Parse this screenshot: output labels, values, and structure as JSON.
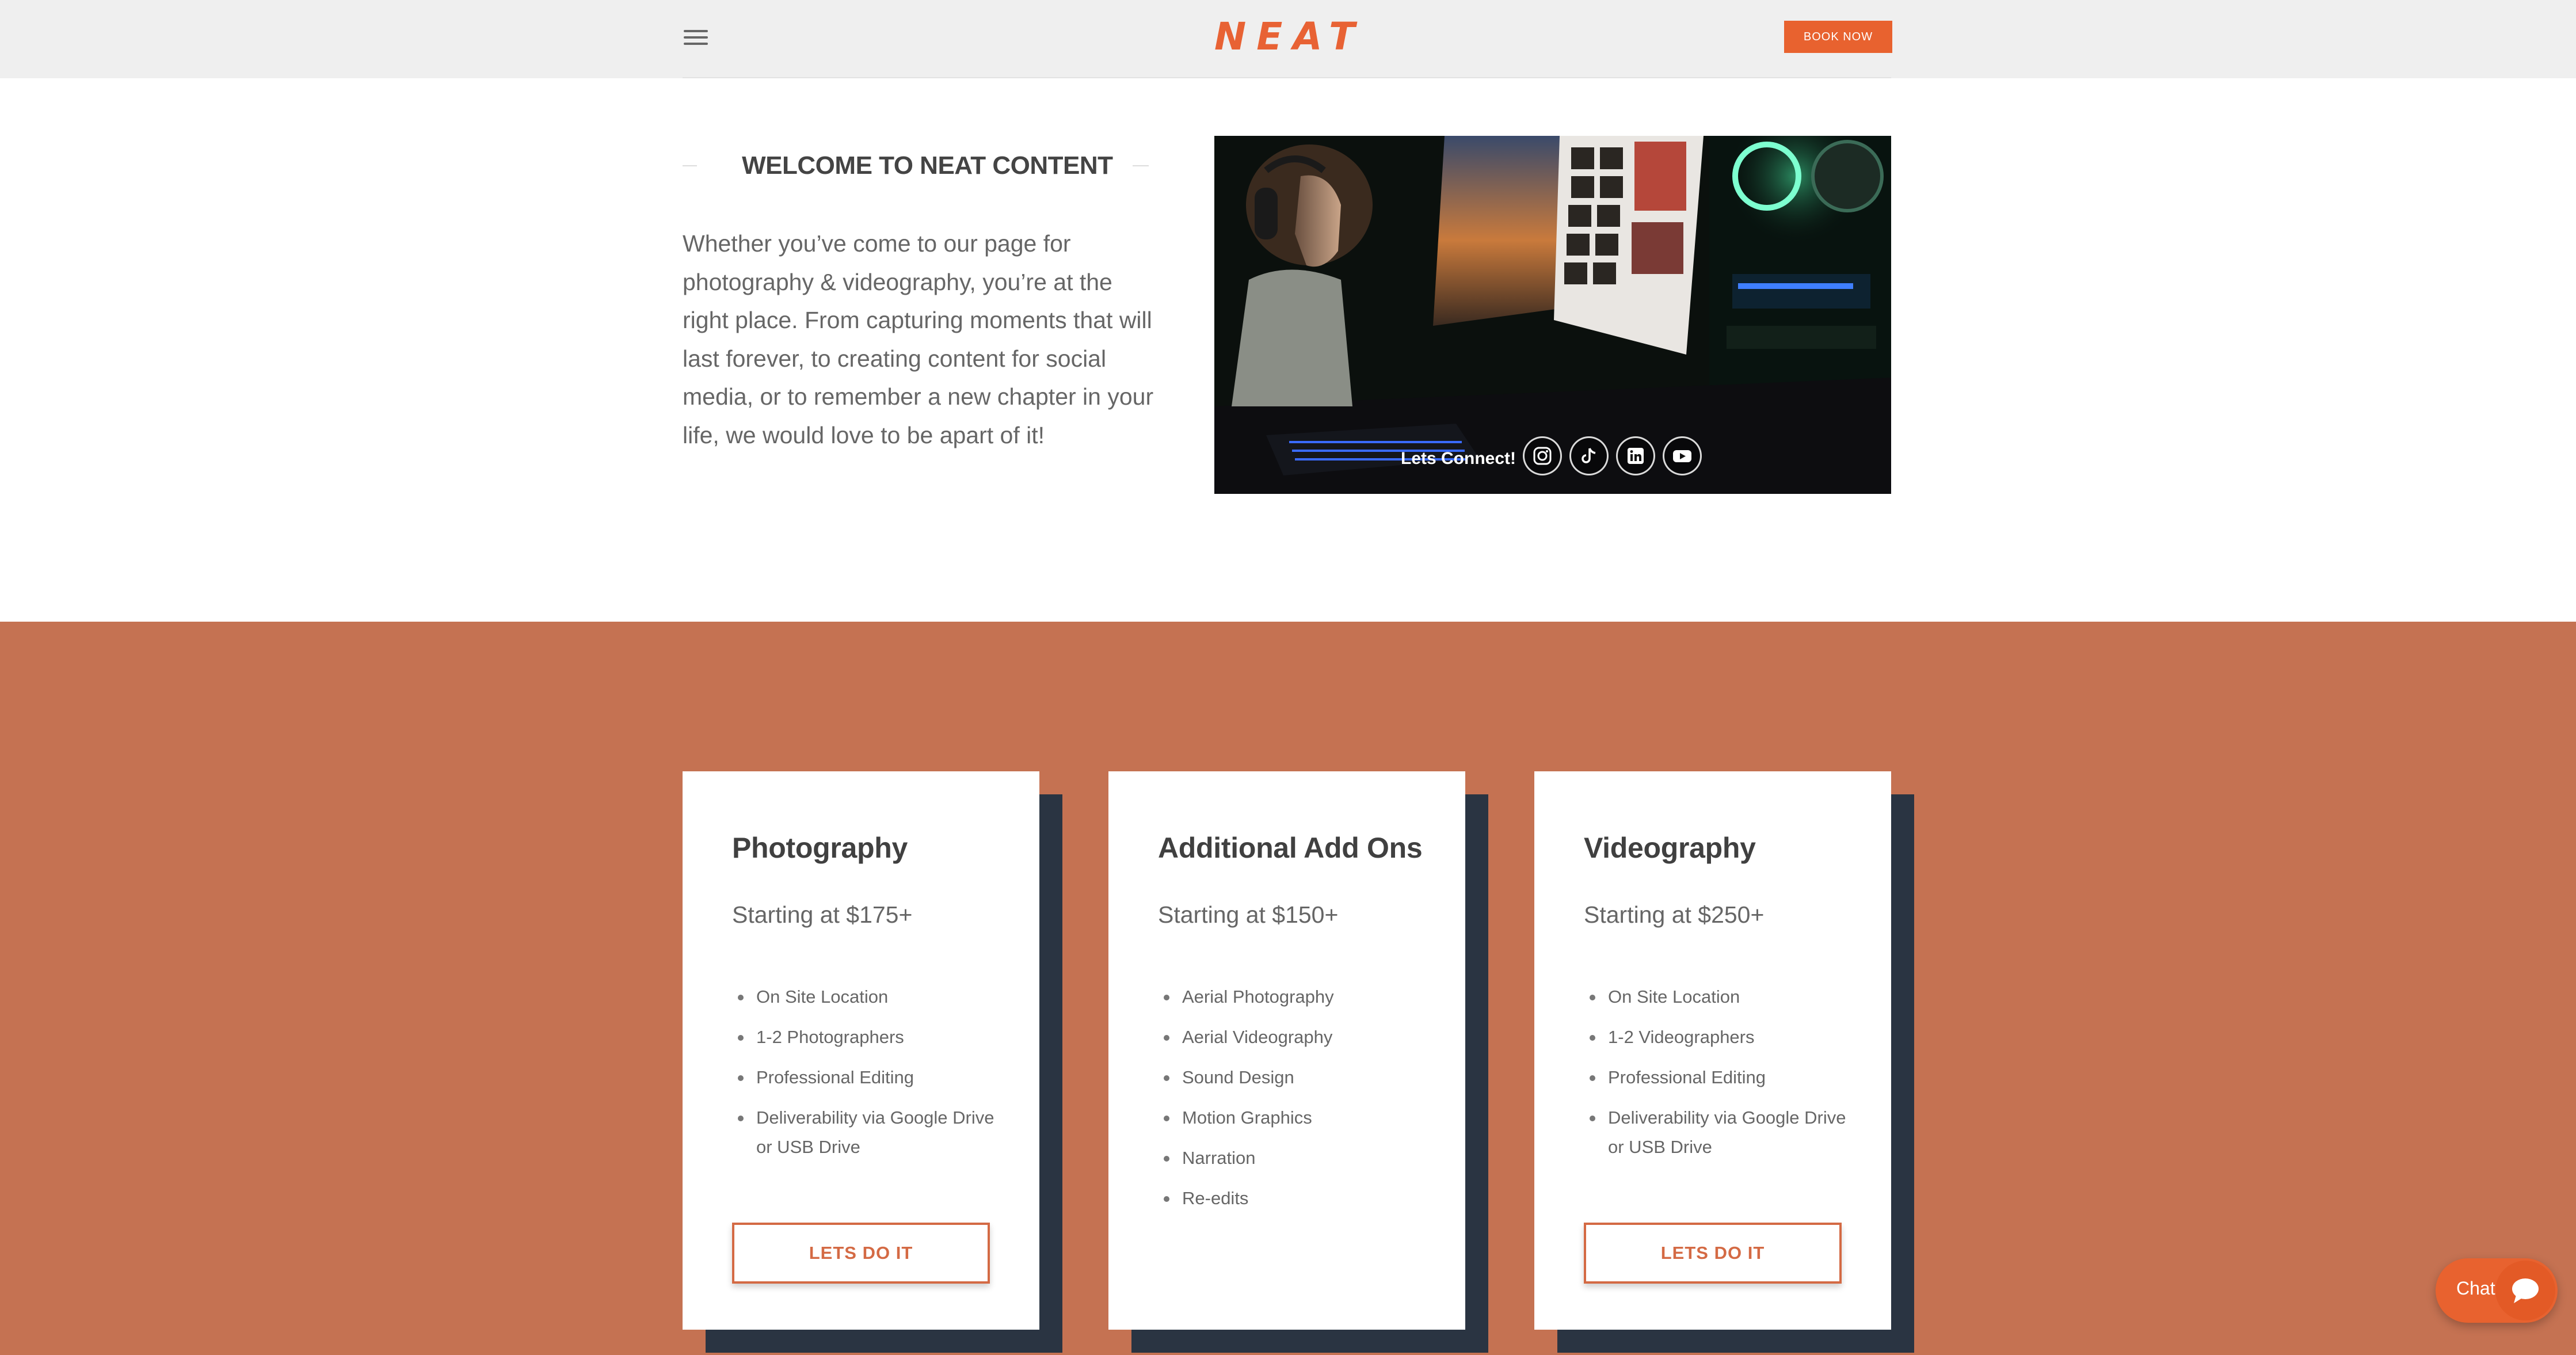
{
  "header": {
    "logo_text": "NEAT",
    "book_button": "BOOK NOW",
    "brand_color": "#e8622f"
  },
  "welcome": {
    "heading": "WELCOME TO NEAT CONTENT",
    "paragraph": "Whether you’ve come to our page for photography & videography, you’re at the right place. From capturing moments that will last forever, to creating content for social media, or to remember a new chapter in your life, we would love to be apart of it!",
    "connect_label": "Lets Connect!",
    "socials": [
      "instagram-icon",
      "tiktok-icon",
      "linkedin-icon",
      "youtube-icon"
    ]
  },
  "services": {
    "band_color": "#c57252",
    "cards": [
      {
        "title": "Photography",
        "price": "Starting at $175+",
        "items": [
          "On Site Location",
          "1-2 Photographers",
          "Professional Editing",
          "Deliverability via Google Drive or USB Drive"
        ],
        "cta": "LETS DO IT"
      },
      {
        "title": "Additional Add Ons",
        "price": "Starting at $150+",
        "items": [
          "Aerial Photography",
          "Aerial Videography",
          "Sound Design",
          "Motion Graphics",
          "Narration",
          "Re-edits"
        ],
        "cta": ""
      },
      {
        "title": "Videography",
        "price": "Starting at $250+",
        "items": [
          "On Site Location",
          "1-2 Videographers",
          "Professional Editing",
          "Deliverability via Google Drive or USB Drive"
        ],
        "cta": "LETS DO IT"
      }
    ]
  },
  "chat": {
    "label": "Chat"
  }
}
